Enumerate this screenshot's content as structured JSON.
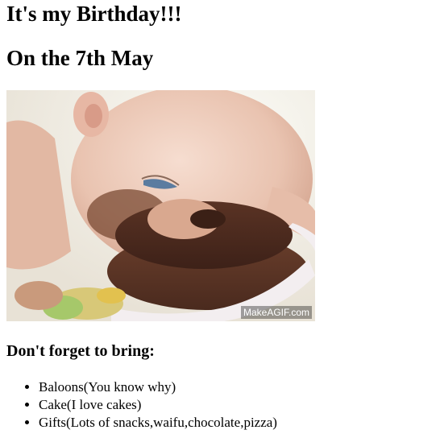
{
  "heading": {
    "title": "It's my Birthday!!!",
    "date": "On the 7th May"
  },
  "image": {
    "watermark": "MakeAGIF.com"
  },
  "bring": {
    "heading": "Don't forget to bring:",
    "items": [
      "Baloons(You know why)",
      "Cake(I love cakes)",
      "Gifts(Lots of snacks,waifu,chocolate,pizza)"
    ]
  }
}
